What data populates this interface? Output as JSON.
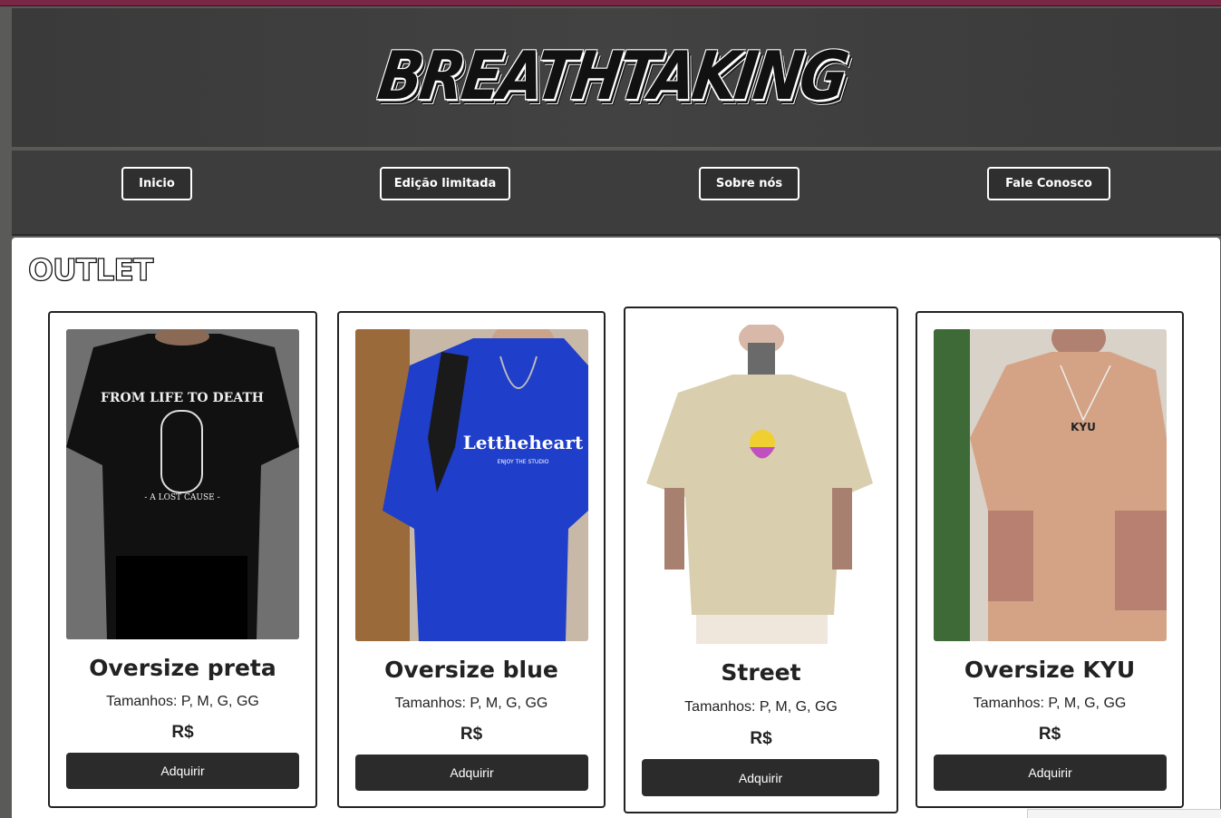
{
  "header": {
    "logo_text": "BREATHTAKING"
  },
  "nav": {
    "items": [
      {
        "label": "Inicio"
      },
      {
        "label": "Edição limitada"
      },
      {
        "label": "Sobre nós"
      },
      {
        "label": "Fale Conosco"
      }
    ]
  },
  "main": {
    "section_title": "OUTLET",
    "products": [
      {
        "name": "Oversize preta",
        "sizes": "Tamanhos: P, M, G, GG",
        "price": "R$",
        "button": "Adquirir",
        "shirt_color": "#111111",
        "print_text": "FROM LIFE TO DEATH",
        "print_sub": "- A LOST CAUSE -"
      },
      {
        "name": "Oversize blue",
        "sizes": "Tamanhos: P, M, G, GG",
        "price": "R$",
        "button": "Adquirir",
        "shirt_color": "#1f3ec9",
        "print_text": "Lettheheart",
        "print_sub": "ENJOY THE STUDIO"
      },
      {
        "name": "Street",
        "sizes": "Tamanhos: P, M, G, GG",
        "price": "R$",
        "button": "Adquirir",
        "shirt_color": "#d9cfae"
      },
      {
        "name": "Oversize KYU",
        "sizes": "Tamanhos: P, M, G, GG",
        "price": "R$",
        "button": "Adquirir",
        "shirt_color": "#d4a386",
        "print_text": "KYU"
      }
    ]
  },
  "colors": {
    "header_bg": "#3f3f3f",
    "nav_bg": "#3d3d3d",
    "button_bg": "#2b2b2b",
    "accent_top": "#7a2746"
  }
}
